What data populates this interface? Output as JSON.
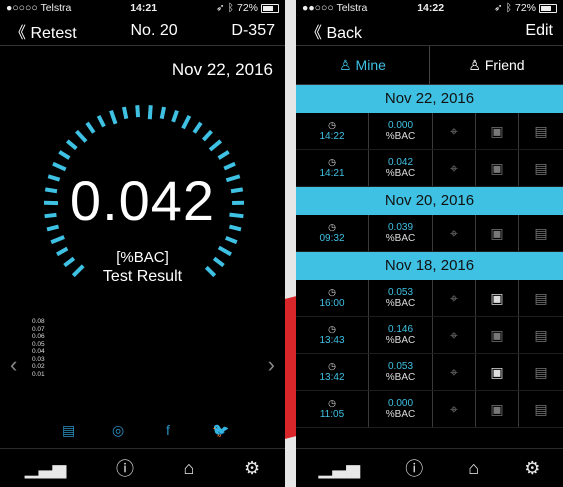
{
  "left": {
    "status": {
      "carrier": "●○○○○ Telstra",
      "time": "14:21",
      "battery": "72%"
    },
    "nav": {
      "back": "Retest",
      "number": "No. 20",
      "device": "D-357"
    },
    "date": "Nov 22, 2016",
    "reading": "0.042",
    "unit": "[%BAC]",
    "label": "Test Result",
    "history": [
      "0.08",
      "0.07",
      "0.06",
      "0.05",
      "0.04",
      "0.03",
      "0.02",
      "0.01"
    ],
    "gauge_fraction": 0.42
  },
  "right": {
    "status": {
      "carrier": "●●○○○ Telstra",
      "time": "14:22",
      "battery": "72%"
    },
    "nav": {
      "back": "Back",
      "edit": "Edit"
    },
    "tabs": {
      "mine": "Mine",
      "friend": "Friend"
    },
    "groups": [
      {
        "date": "Nov 22, 2016",
        "rows": [
          {
            "time": "14:22",
            "bac": "0.000",
            "unit": "%BAC"
          },
          {
            "time": "14:21",
            "bac": "0.042",
            "unit": "%BAC"
          }
        ]
      },
      {
        "date": "Nov 20, 2016",
        "rows": [
          {
            "time": "09:32",
            "bac": "0.039",
            "unit": "%BAC"
          }
        ]
      },
      {
        "date": "Nov 18, 2016",
        "rows": [
          {
            "time": "16:00",
            "bac": "0.053",
            "unit": "%BAC"
          },
          {
            "time": "13:43",
            "bac": "0.146",
            "unit": "%BAC"
          },
          {
            "time": "13:42",
            "bac": "0.053",
            "unit": "%BAC"
          },
          {
            "time": "11:05",
            "bac": "0.000",
            "unit": "%BAC"
          }
        ]
      }
    ]
  },
  "colors": {
    "accent": "#3fc1e3",
    "red": "#d8262b"
  }
}
